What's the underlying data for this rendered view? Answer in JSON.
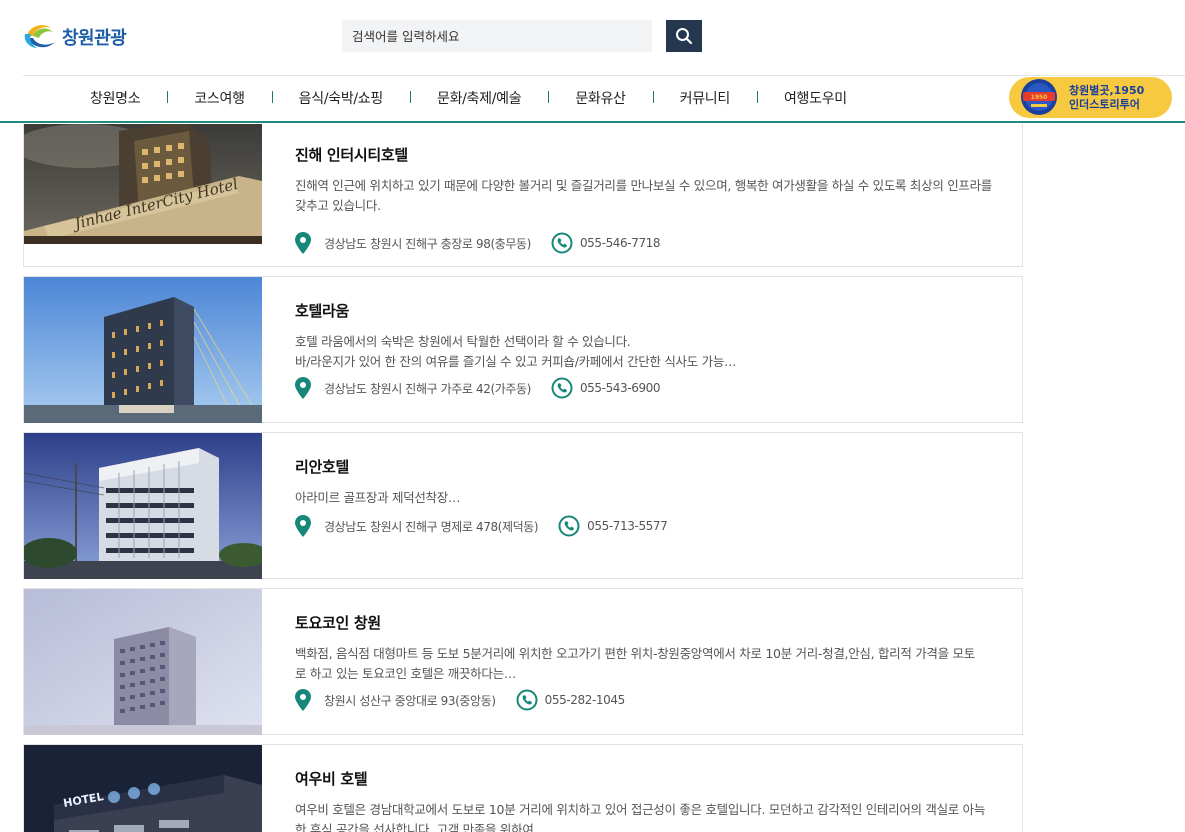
{
  "header": {
    "logo_text": "창원관광",
    "search": {
      "placeholder": "검색어를 입력하세요"
    },
    "nav": [
      "창원명소",
      "코스여행",
      "음식/숙박/쇼핑",
      "문화/축제/예술",
      "문화유산",
      "커뮤니티",
      "여행도우미"
    ],
    "banner": {
      "line1": "창원별곳,1950",
      "line2": "인더스토리투어"
    }
  },
  "colors": {
    "accent": "#1e8c80",
    "search_button": "#25364f",
    "banner_bg": "#f7c940"
  },
  "listings": [
    {
      "title": "진해 인터시티호텔",
      "desc": "진해역 인근에 위치하고 있기 때문에 다양한 볼거리 및 즐길거리를 만나보실 수 있으며,  행복한 여가생활을 하실 수 있도록 최상의 인프라를 갖추고 있습니다.",
      "address": "경상남도 창원시 진해구 충장로 98(충무동)",
      "phone": "055-546-7718",
      "sign_text": "Jinhae InterCity Hotel"
    },
    {
      "title": "호텔라움",
      "desc": "호텔 라움에서의 숙박은 창원에서 탁월한 선택이라 할 수 있습니다.\n바/라운지가 있어 한 잔의 여유를 즐기실 수 있고 커피숍/카페에서 간단한 식사도 가능…",
      "address": "경상남도 창원시 진해구 가주로 42(가주동)",
      "phone": "055-543-6900"
    },
    {
      "title": "리안호텔",
      "desc": "아라미르 골프장과 제덕선착장…",
      "address": "경상남도 창원시 진해구 명제로 478(제덕동)",
      "phone": "055-713-5577"
    },
    {
      "title": "토요코인 창원",
      "desc": "백화점, 음식점 대형마트 등 도보 5분거리에 위치한 오고가기 편한 위치-창원중앙역에서 차로 10분 거리-청결,안심, 합리적 가격을 모토로 하고 있는 토요코인 호텔은 깨끗하다는…",
      "address": "창원시 성산구 중앙대로 93(중앙동)",
      "phone": "055-282-1045"
    },
    {
      "title": "여우비 호텔",
      "desc": "여우비 호텔은 경남대학교에서 도보로 10분 거리에 위치하고 있어 접근성이 좋은 호텔입니다. 모던하고 감각적인 인테리어의 객실로 아늑한 휴식 공간을 선사합니다. 고객 만족을 위하여 …",
      "sign_text": "HOTEL"
    }
  ]
}
